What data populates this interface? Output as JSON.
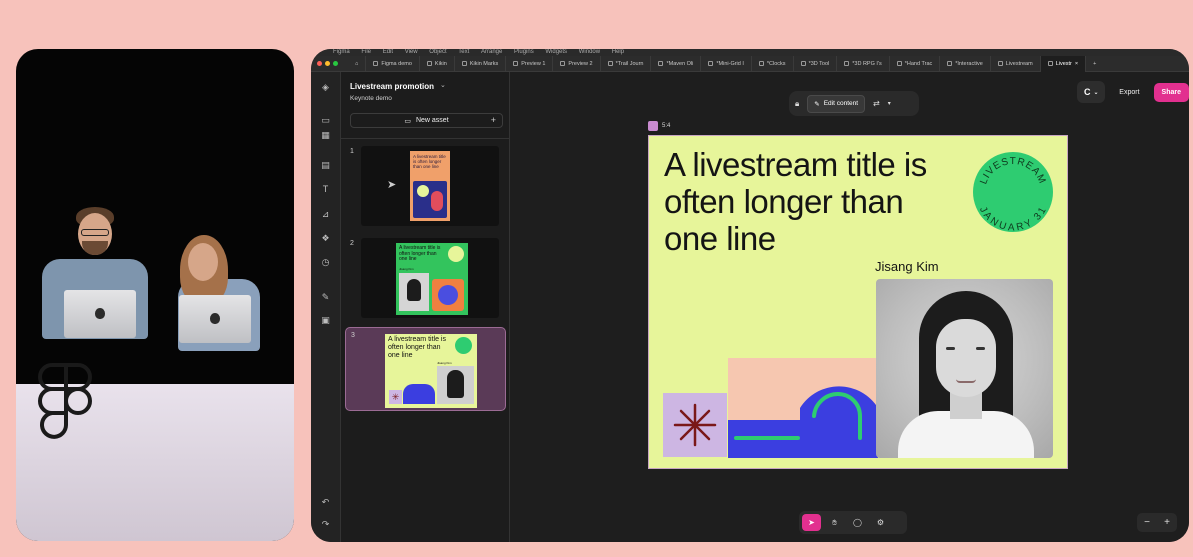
{
  "colors": {
    "background": "#f7c2bb",
    "accent": "#e2308f",
    "slide_bg": "#e7f59a",
    "badge_green": "#2ecc71",
    "shape_blue": "#3b3ee0"
  },
  "menubar": [
    "Figma",
    "File",
    "Edit",
    "View",
    "Object",
    "Text",
    "Arrange",
    "Plugins",
    "Widgets",
    "Window",
    "Help"
  ],
  "tabs": [
    {
      "label": "Figma demo",
      "icon": "figma-file-icon"
    },
    {
      "label": "Kikin",
      "icon": "figma-file-icon"
    },
    {
      "label": "Kikin Marks",
      "icon": "figma-file-icon"
    },
    {
      "label": "Preview 1",
      "icon": "figma-file-icon"
    },
    {
      "label": "Preview 2",
      "icon": "figma-file-icon"
    },
    {
      "label": "*Trail Journ",
      "icon": "figma-file-icon"
    },
    {
      "label": "*Maven Oli",
      "icon": "figma-file-icon"
    },
    {
      "label": "*Mini-Grid I",
      "icon": "figma-file-icon"
    },
    {
      "label": "*Clocks",
      "icon": "figma-file-icon"
    },
    {
      "label": "*3D Tool",
      "icon": "figma-file-icon"
    },
    {
      "label": "*3D RPG I's",
      "icon": "figma-file-icon"
    },
    {
      "label": "*Hand Trac",
      "icon": "figma-file-icon"
    },
    {
      "label": "*Interactive",
      "icon": "figma-file-icon"
    },
    {
      "label": "Livestream",
      "icon": "figma-file-icon"
    },
    {
      "label": "Livestr",
      "icon": "figma-file-icon"
    }
  ],
  "panel": {
    "title": "Livestream promotion",
    "subtitle": "Keynote demo",
    "new_asset_label": "New asset",
    "slides": [
      {
        "number": "1",
        "thumb_title": "A livestream title is often longer than one line"
      },
      {
        "number": "2",
        "thumb_title": "A livestream title is often longer than one line",
        "thumb_name": "Jisang Kim"
      },
      {
        "number": "3",
        "thumb_title": "A livestream title is often longer than one line",
        "thumb_name": "Jisang Kim"
      }
    ]
  },
  "canvas_toolbar": {
    "edit_content_label": "Edit content"
  },
  "header_actions": {
    "export_label": "Export",
    "share_label": "Share"
  },
  "frame": {
    "label": "5:4"
  },
  "slide": {
    "title": "A livestream title is often longer than one line",
    "presenter": "Jisang Kim",
    "badge_line1": "LIVESTREAM",
    "badge_line2": "JANUARY 31"
  },
  "zoom": {
    "minus": "−",
    "plus": "+"
  }
}
